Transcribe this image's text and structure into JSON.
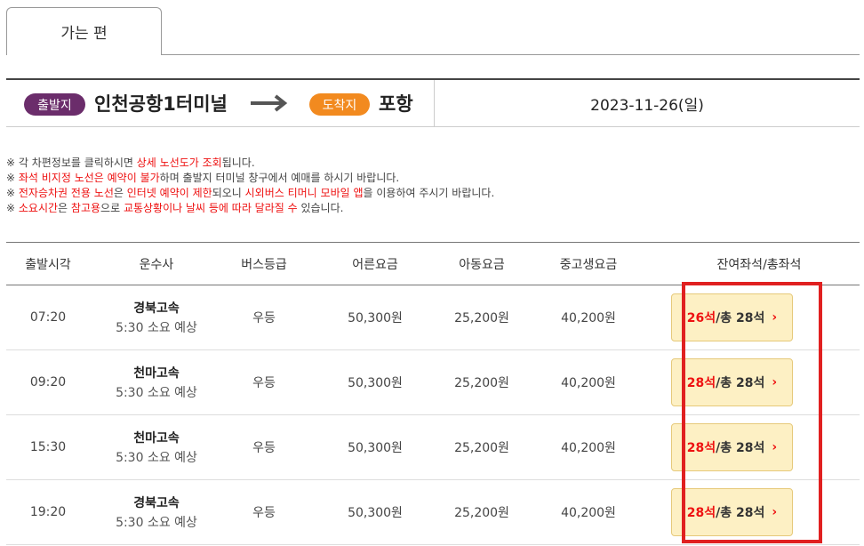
{
  "tabs": [
    {
      "label": "가는 편"
    }
  ],
  "route": {
    "departure_badge": "출발지",
    "departure": "인천공항1터미널",
    "arrival_badge": "도착지",
    "arrival": "포항",
    "date": "2023-11-26(일)"
  },
  "notices": [
    [
      {
        "t": "※ 각 차편정보를 클릭하시면 ",
        "red": false
      },
      {
        "t": "상세 노선도가 조회",
        "red": true
      },
      {
        "t": "됩니다.",
        "red": false
      }
    ],
    [
      {
        "t": "※ ",
        "red": false
      },
      {
        "t": "좌석 비지정 노선은 예약이 불가",
        "red": true
      },
      {
        "t": "하며 출발지 터미널 창구에서 예매를 하시기 바랍니다.",
        "red": false
      }
    ],
    [
      {
        "t": "※ ",
        "red": false
      },
      {
        "t": "전자승차권 전용 노선",
        "red": true
      },
      {
        "t": "은 ",
        "red": false
      },
      {
        "t": "인터넷 예약이 제한",
        "red": true
      },
      {
        "t": "되오니 ",
        "red": false
      },
      {
        "t": "시외버스 티머니 모바일 앱",
        "red": true
      },
      {
        "t": "을 이용하여 주시기 바랍니다.",
        "red": false
      }
    ],
    [
      {
        "t": "※ ",
        "red": false
      },
      {
        "t": "소요시간",
        "red": true
      },
      {
        "t": "은 ",
        "red": false
      },
      {
        "t": "참고용",
        "red": true
      },
      {
        "t": "으로 ",
        "red": false
      },
      {
        "t": "교통상황이나 날씨 등에 따라 달라질 수",
        "red": true
      },
      {
        "t": " 있습니다.",
        "red": false
      }
    ]
  ],
  "table": {
    "headers": [
      "출발시각",
      "운수사",
      "버스등급",
      "어른요금",
      "아동요금",
      "중고생요금",
      "잔여좌석/총좌석"
    ],
    "rows": [
      {
        "time": "07:20",
        "company": "경북고속",
        "duration": "5:30 소요 예상",
        "grade": "우등",
        "adult": "50,300원",
        "child": "25,200원",
        "student": "40,200원",
        "remaining": "26석",
        "total": " /총 28석"
      },
      {
        "time": "09:20",
        "company": "천마고속",
        "duration": "5:30 소요 예상",
        "grade": "우등",
        "adult": "50,300원",
        "child": "25,200원",
        "student": "40,200원",
        "remaining": "28석",
        "total": " /총 28석"
      },
      {
        "time": "15:30",
        "company": "천마고속",
        "duration": "5:30 소요 예상",
        "grade": "우등",
        "adult": "50,300원",
        "child": "25,200원",
        "student": "40,200원",
        "remaining": "28석",
        "total": " /총 28석"
      },
      {
        "time": "19:20",
        "company": "경북고속",
        "duration": "5:30 소요 예상",
        "grade": "우등",
        "adult": "50,300원",
        "child": "25,200원",
        "student": "40,200원",
        "remaining": "28석",
        "total": " /총 28석"
      }
    ]
  },
  "icons": {
    "route_arrow": "right-arrow-icon",
    "seat_chevron": "chevron-right-icon"
  },
  "colors": {
    "departure_badge": "#6b2d6b",
    "arrival_badge": "#f28a1f",
    "highlight": "#e02020",
    "seat_button_bg": "#fdf0c4",
    "notice_red": "#e11111"
  }
}
